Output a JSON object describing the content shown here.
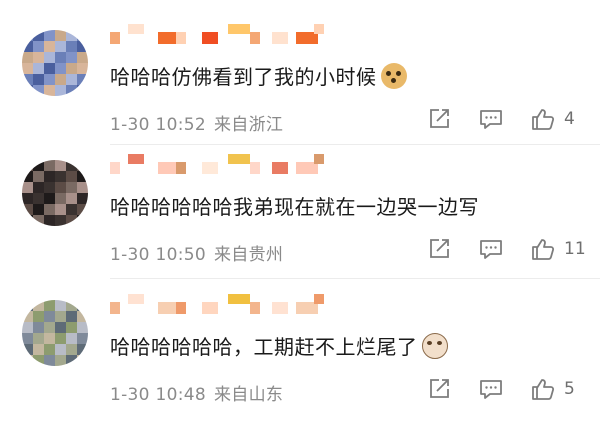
{
  "comments": [
    {
      "text": "哈哈哈仿佛看到了我的小时候",
      "emoji": "doge-emoji",
      "date": "1-30 10:52",
      "location": "来自浙江",
      "like_count": "4",
      "avatar_colors": [
        "#6a7fb8",
        "#4a5f9e",
        "#8193c8",
        "#c9a98a",
        "#d8b59a",
        "#aab6d9"
      ],
      "name_colors": [
        "#f4a774",
        "#ffe2cf",
        "#f26c2b",
        "#ffd1b3",
        "#f04e23",
        "#ffc76a"
      ]
    },
    {
      "text": "哈哈哈哈哈哈我弟现在就在一边哭一边写",
      "emoji": "",
      "date": "1-30 10:50",
      "location": "来自贵州",
      "like_count": "11",
      "avatar_colors": [
        "#3a3230",
        "#5c4c46",
        "#1e1a1a",
        "#7a6a63",
        "#a8908a",
        "#2d2626"
      ],
      "name_colors": [
        "#ffd7c9",
        "#e97b63",
        "#ffc9b7",
        "#d99a6c",
        "#ffe9d9",
        "#f1c34e"
      ]
    },
    {
      "text": "哈哈哈哈哈哈，工期赶不上烂尾了",
      "emoji": "cat-emoji",
      "date": "1-30 10:48",
      "location": "来自山东",
      "like_count": "5",
      "avatar_colors": [
        "#7f8a9a",
        "#a3a88e",
        "#5e6b77",
        "#c3b79f",
        "#8d9c6f",
        "#b8bcc7"
      ],
      "name_colors": [
        "#f3b58d",
        "#ffe2d2",
        "#f7cfb2",
        "#ef9a6a",
        "#ffd6bf",
        "#f1c040"
      ]
    }
  ],
  "icons": [
    "share-icon",
    "comment-icon",
    "like-icon"
  ]
}
